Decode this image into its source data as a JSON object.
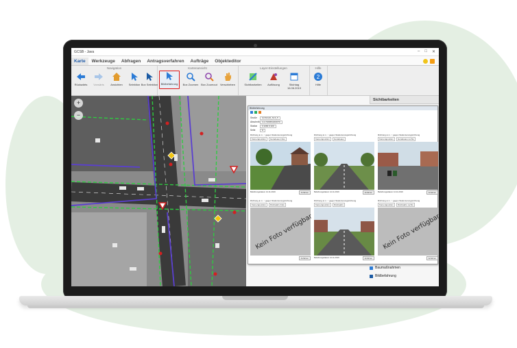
{
  "window": {
    "title": "GCSB - Java"
  },
  "tabs": [
    {
      "label": "Karte"
    },
    {
      "label": "Werkzeuge"
    },
    {
      "label": "Abfragen"
    },
    {
      "label": "Antragsverfahren"
    },
    {
      "label": "Aufträge"
    },
    {
      "label": "Objekteditor"
    }
  ],
  "ribbon": {
    "groups": {
      "navigation": "Navigation",
      "kartenansicht": "Kartenansicht",
      "layer": "Layer-Einstellungen",
      "hilfe": "Hilfe"
    },
    "buttons": {
      "back": "Rückwärts",
      "forward": "Vorwärts",
      "view": "Ansichten",
      "select": "Selektion",
      "box_select": "Box Selektion",
      "bildbefahrung": "Bildbefahrung",
      "box_zoom": "Box Zoomen",
      "box_zoom_out": "Box Zoomout",
      "move": "Verschieben",
      "visibilities": "Sichtbarkeiten",
      "resolution": "Auflösung",
      "date_label": "Stichtag",
      "date_value": "16.06.2019",
      "help": "Hilfe"
    }
  },
  "panel": {
    "header": "Sichtbarkeiten",
    "dialog_title": "Bildbefahrung",
    "form": [
      {
        "k": "Straße",
        "v": "GCSCHO_Nr.6_5"
      },
      {
        "k": "Abschnitt",
        "v": "3.4.7406654/20/070"
      },
      {
        "k": "Station",
        "v": "0   1066   0   100"
      },
      {
        "k": "Seite",
        "v": "H"
      },
      {
        "k": "Kamera",
        "v": "rechts"
      }
    ],
    "cells": [
      {
        "opts": "Richtung  ● m.   ○ gegen Stationierungsrichtung",
        "sel": [
          "Kameraposition",
          "Geradeaus links"
        ],
        "caption": "Befahrungsdatum 14.11.2019",
        "btn": "Anfahren",
        "photo": "road-grass-houses"
      },
      {
        "opts": "Richtung  ● m.   ○ gegen Stationierungsrichtung",
        "sel": [
          "Kameraposition",
          "Geradeaus"
        ],
        "caption": "Befahrungsdatum 14.11.2019",
        "btn": "Anfahren",
        "photo": "road-straight"
      },
      {
        "opts": "Richtung  ● m.   ○ gegen Stationierungsrichtung",
        "sel": [
          "Kameraposition",
          "Geradeaus rechts"
        ],
        "caption": "Befahrungsdatum 14.11.2019",
        "btn": "Anfahren",
        "photo": "road-bins-houses"
      },
      {
        "opts": "Richtung  ● m.   ○ gegen Stationierungsrichtung",
        "sel": [
          "Kameraposition",
          "Rückwärts links"
        ],
        "caption": "",
        "btn": "Anfahren",
        "nophoto": "Kein Foto verfügbar"
      },
      {
        "opts": "Richtung  ● m.   ○ gegen Stationierungsrichtung",
        "sel": [
          "Kameraposition",
          "Rückwärts"
        ],
        "caption": "Befahrungsdatum 14.11.2019",
        "btn": "Anfahren",
        "photo": "road-back"
      },
      {
        "opts": "Richtung  ● m.   ○ gegen Stationierungsrichtung",
        "sel": [
          "Kameraposition",
          "Rückwärts rechts"
        ],
        "caption": "",
        "btn": "Anfahren",
        "nophoto": "Kein Foto verfügbar"
      }
    ],
    "layers": [
      {
        "label": "Baumaßnahmen"
      },
      {
        "label": "Bildbefahrung"
      }
    ]
  },
  "colors": {
    "accent": "#1e5aa8",
    "highlight": "#d11111",
    "map_line_green": "#2ecc40",
    "map_line_purple": "#5a3fd0"
  }
}
